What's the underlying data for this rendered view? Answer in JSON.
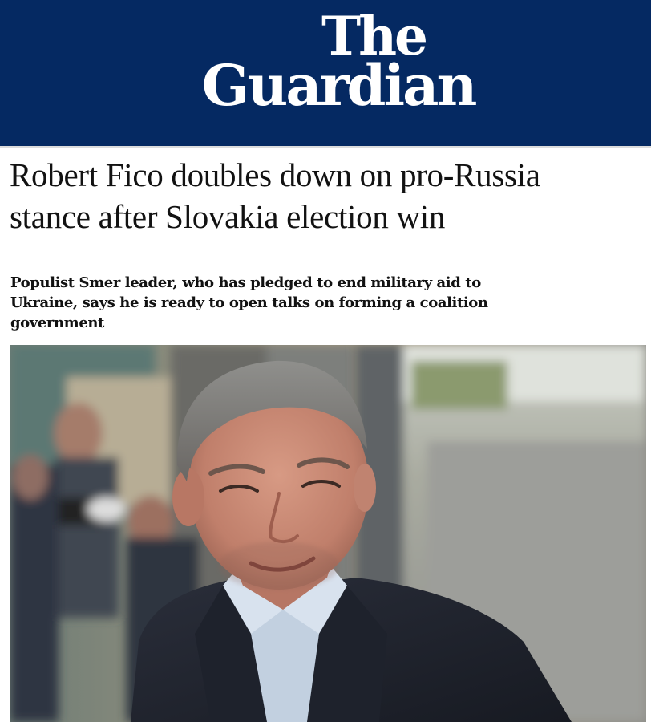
{
  "masthead": {
    "logo_line_1": "The",
    "logo_line_2": "Guardian",
    "brand_color": "#052962"
  },
  "article": {
    "headline_line_1": "Robert Fico doubles down on pro-Russia",
    "headline_line_2": "stance after Slovakia election win",
    "standfirst_line_1": "Populist Smer leader, who has pledged to end military aid to",
    "standfirst_line_2": "Ukraine, says he is ready to open talks on forming a coalition",
    "standfirst_line_3": "government"
  },
  "hero_image": {
    "subject": "photo of a grey-haired man in a dark blazer and light blue shirt, blurred photographers in background"
  }
}
